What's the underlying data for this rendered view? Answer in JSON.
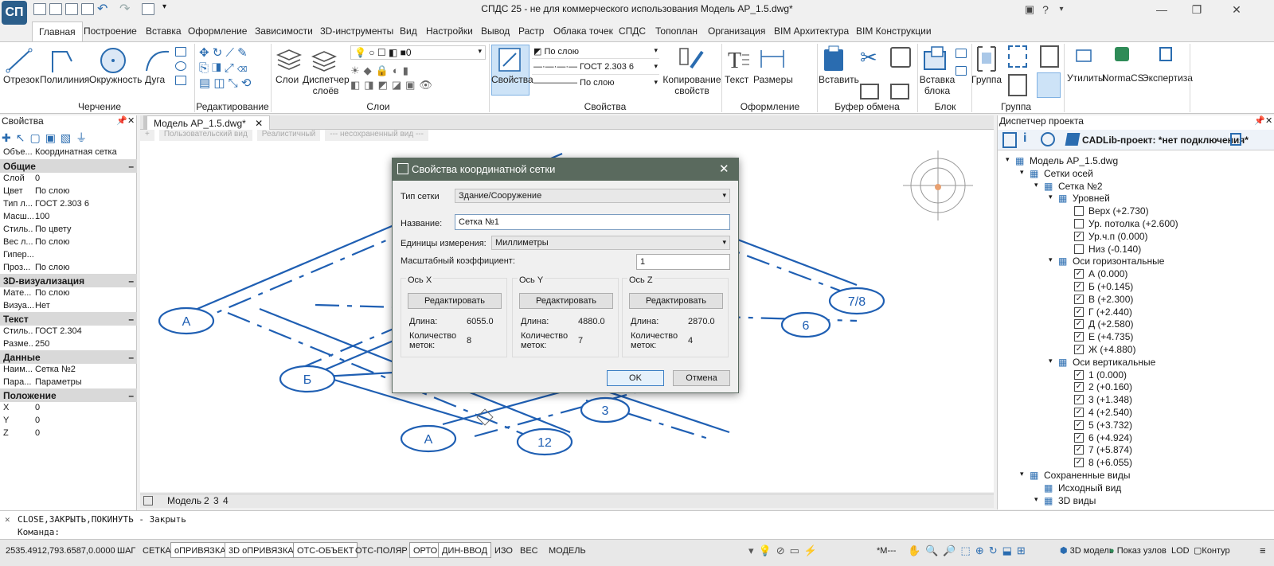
{
  "window": {
    "title": "СПДС 25 - не для коммерческого использования Модель АР_1.5.dwg*",
    "logo": "СП"
  },
  "menu": {
    "tabs": [
      "Главная",
      "Построение",
      "Вставка",
      "Оформление",
      "Зависимости",
      "3D-инструменты",
      "Вид",
      "Настройки",
      "Вывод",
      "Растр",
      "Облака точек",
      "СПДС",
      "Топоплан",
      "Организация",
      "BIM Архитектура",
      "BIM Конструкции"
    ]
  },
  "ribbon": {
    "draw": {
      "line": "Отрезок",
      "polyline": "Полилиния",
      "circle": "Окружность",
      "arc": "Дуга",
      "group": "Черчение"
    },
    "edit": {
      "group": "Редактирование"
    },
    "layers": {
      "layers_btn": "Слои",
      "dispatcher": "Диспетчер",
      "dispatcher2": "слоёв",
      "group": "Слои",
      "current": "0"
    },
    "props": {
      "btn": "Свойства",
      "color": "По слою",
      "linetype": "ГОСТ 2.303 6",
      "lineweight": "По слою",
      "copy1": "Копирование",
      "copy2": "свойств",
      "group": "Свойства"
    },
    "annotate": {
      "text": "Текст",
      "dims": "Размеры",
      "group": "Оформление"
    },
    "clipboard": {
      "paste": "Вставить",
      "group": "Буфер обмена"
    },
    "block": {
      "insert1": "Вставка",
      "insert2": "блока",
      "group": "Блок"
    },
    "grouping": {
      "btn": "Группа",
      "group": "Группа"
    },
    "extra": {
      "utils": "Утилиты",
      "normacs": "NormaCS",
      "expert": "Экспертиза"
    }
  },
  "properties": {
    "title": "Свойства",
    "object_label": "Объе...",
    "object_value": "Координатная сетка",
    "sections": [
      {
        "name": "Общие",
        "rows": [
          [
            "Слой",
            "0"
          ],
          [
            "Цвет",
            "По слою"
          ],
          [
            "Тип л...",
            "ГОСТ 2.303 6"
          ],
          [
            "Масш...",
            "100"
          ],
          [
            "Стиль...",
            "По цвету"
          ],
          [
            "Вес л...",
            "По слою"
          ],
          [
            "Гипер...",
            ""
          ],
          [
            "Проз...",
            "По слою"
          ]
        ]
      },
      {
        "name": "3D-визуализация",
        "rows": [
          [
            "Мате...",
            "По слою"
          ],
          [
            "Визуа...",
            "Нет"
          ]
        ]
      },
      {
        "name": "Текст",
        "rows": [
          [
            "Стиль...",
            "ГОСТ 2.304"
          ],
          [
            "Разме...",
            "250"
          ]
        ]
      },
      {
        "name": "Данные",
        "rows": [
          [
            "Наим...",
            "Сетка №2"
          ],
          [
            "Пара...",
            "Параметры"
          ]
        ]
      },
      {
        "name": "Положение",
        "rows": [
          [
            "X",
            "0"
          ],
          [
            "Y",
            "0"
          ],
          [
            "Z",
            "0"
          ]
        ]
      }
    ]
  },
  "document": {
    "tab": "Модель АР_1.5.dwg*",
    "view_tabs": [
      "+",
      "Пользовательский вид",
      "Реалистичный",
      "--- несохраненный вид ---"
    ],
    "model_tabs": [
      "Модель",
      "2",
      "3",
      "4"
    ],
    "bubbles": [
      "А",
      "Б",
      "3",
      "12",
      "6",
      "7/8"
    ]
  },
  "dialog": {
    "title": "Свойства координатной сетки",
    "grid_type_label": "Тип сетки",
    "grid_type_value": "Здание/Сооружение",
    "name_label": "Название:",
    "name_value": "Сетка №1",
    "units_label": "Единицы измерения:",
    "units_value": "Миллиметры",
    "scale_label": "Масштабный коэффициент:",
    "scale_value": "1",
    "edit_btn": "Редактировать",
    "length_label": "Длина:",
    "count_label1": "Количество",
    "count_label2": "меток:",
    "axes": [
      {
        "name": "Ось X",
        "length": "6055.0",
        "count": "8"
      },
      {
        "name": "Ось Y",
        "length": "4880.0",
        "count": "7"
      },
      {
        "name": "Ось Z",
        "length": "2870.0",
        "count": "4"
      }
    ],
    "ok": "OK",
    "cancel": "Отмена"
  },
  "project": {
    "title": "Диспетчер проекта",
    "cadlib": "CADLib-проект:  *нет подключения*",
    "model": "Модель АР_1.5.dwg",
    "grids": "Сетки осей",
    "grid2": "Сетка №2",
    "levels": "Уровней",
    "level_items": [
      [
        "Верх (+2.730)",
        false
      ],
      [
        "Ур. потолка (+2.600)",
        false
      ],
      [
        "Ур.ч.п (0.000)",
        true
      ],
      [
        "Низ (-0.140)",
        false
      ]
    ],
    "horiz": "Оси горизонтальные",
    "horiz_items": [
      "А (0.000)",
      "Б (+0.145)",
      "В (+2.300)",
      "Г (+2.440)",
      "Д (+2.580)",
      "Е (+4.735)",
      "Ж (+4.880)"
    ],
    "vert": "Оси вертикальные",
    "vert_items": [
      "1 (0.000)",
      "2 (+0.160)",
      "3 (+1.348)",
      "4 (+2.540)",
      "5 (+3.732)",
      "6 (+4.924)",
      "7 (+5.874)",
      "8 (+6.055)"
    ],
    "saved": "Сохраненные виды",
    "initial": "Исходный вид",
    "views3d": "3D виды"
  },
  "command": {
    "history": "CLOSE,ЗАКРЫТЬ,ПОКИНУТЬ - Закрыть",
    "prompt": "Команда:"
  },
  "status": {
    "coords": "2535.4912,793.6587,0.0000",
    "toggles": [
      [
        "ШАГ",
        false
      ],
      [
        "СЕТКА",
        false
      ],
      [
        "оПРИВЯЗКА",
        true
      ],
      [
        "3D оПРИВЯЗКА",
        true
      ],
      [
        "ОТС-ОБЪЕКТ",
        true
      ],
      [
        "ОТС-ПОЛЯР",
        false
      ],
      [
        "ОРТО",
        true
      ],
      [
        "ДИН-ВВОД",
        true
      ],
      [
        "ИЗО",
        false
      ],
      [
        "ВЕС",
        false
      ]
    ],
    "model": "МОДЕЛЬ",
    "scale": "*М---",
    "view3d": "3D модель",
    "nodes": "Показ узлов",
    "lod": "LOD",
    "contour": "Контур"
  },
  "colors": {
    "accent": "#2a6cb0",
    "dialog_title": "#5a6a5e",
    "drawing": "#1f5fb3"
  }
}
